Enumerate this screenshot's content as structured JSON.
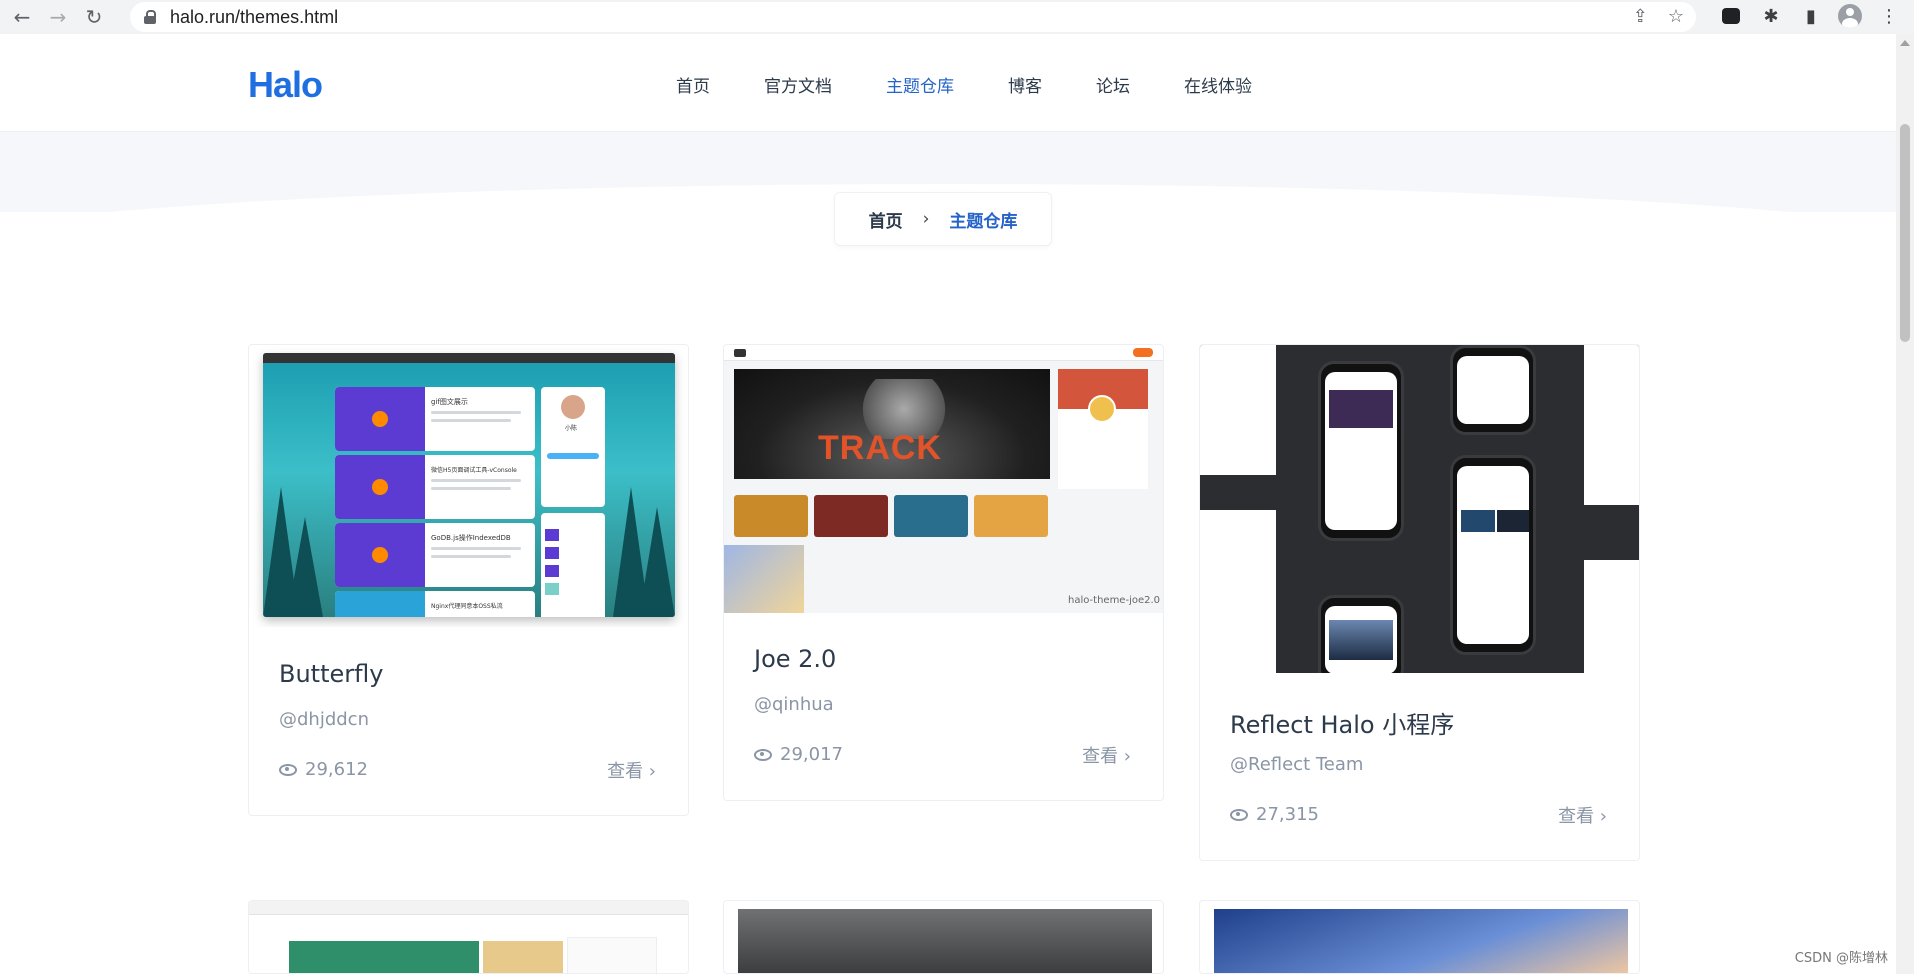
{
  "browser": {
    "url": "halo.run/themes.html"
  },
  "header": {
    "logo": "Halo",
    "nav": [
      {
        "label": "首页",
        "active": false
      },
      {
        "label": "官方文档",
        "active": false
      },
      {
        "label": "主题仓库",
        "active": true
      },
      {
        "label": "博客",
        "active": false
      },
      {
        "label": "论坛",
        "active": false
      },
      {
        "label": "在线体验",
        "active": false
      }
    ]
  },
  "breadcrumb": {
    "home": "首页",
    "separator": "›",
    "current": "主题仓库"
  },
  "cards": [
    {
      "title": "Butterfly",
      "author": "@dhjddcn",
      "views": "29,612",
      "view_label": "查看 ›"
    },
    {
      "title": "Joe 2.0",
      "author": "@qinhua",
      "views": "29,017",
      "view_label": "查看 ›"
    },
    {
      "title": "Reflect Halo 小程序",
      "author": "@Reflect Team",
      "views": "27,315",
      "view_label": "查看 ›"
    }
  ],
  "thumbnails": {
    "butterfly_posts": [
      "gif图文展示",
      "微信H5页面调试工具-vConsole",
      "GoDB.js操作IndexedDB",
      "Nginx代理同意本OSS私流"
    ],
    "butterfly_profile": "小陈",
    "joe_banner": "TRACK",
    "joe_caption": "halo-theme-joe2.0"
  },
  "watermark": "CSDN @陈增林",
  "colors": {
    "accent": "#2563c9",
    "logo": "#1f6fe0"
  }
}
